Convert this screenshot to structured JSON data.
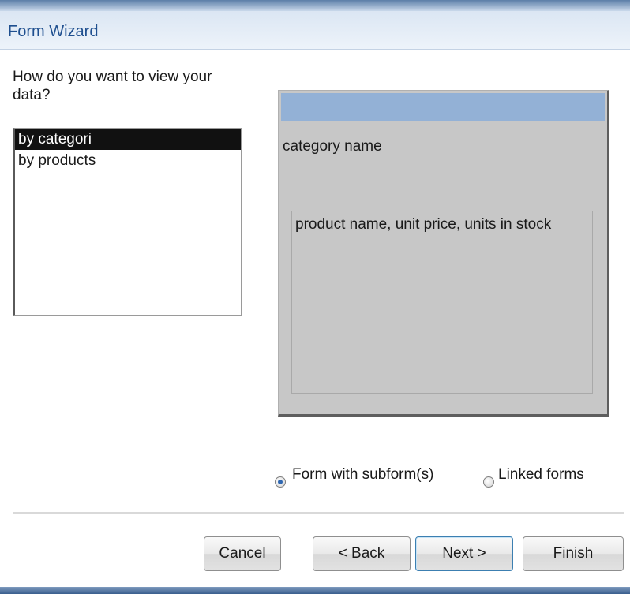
{
  "window": {
    "title": "Form Wizard"
  },
  "prompt": "How do you want to view your data?",
  "view_list": {
    "items": [
      {
        "label": "by categori",
        "selected": true
      },
      {
        "label": "by products",
        "selected": false
      }
    ]
  },
  "preview": {
    "main_field": "category name",
    "subform_fields": "product name, unit price, units in stock"
  },
  "layout_options": {
    "subform": {
      "label": "Form with subform(s)",
      "checked": true
    },
    "linked": {
      "label": "Linked forms",
      "checked": false
    }
  },
  "buttons": {
    "cancel": "Cancel",
    "back": "< Back",
    "next": "Next >",
    "finish": "Finish"
  },
  "colors": {
    "title_text": "#1f4f8f",
    "preview_header": "#93b1d6",
    "preview_bg": "#c7c7c7",
    "selection_bg": "#111111"
  }
}
